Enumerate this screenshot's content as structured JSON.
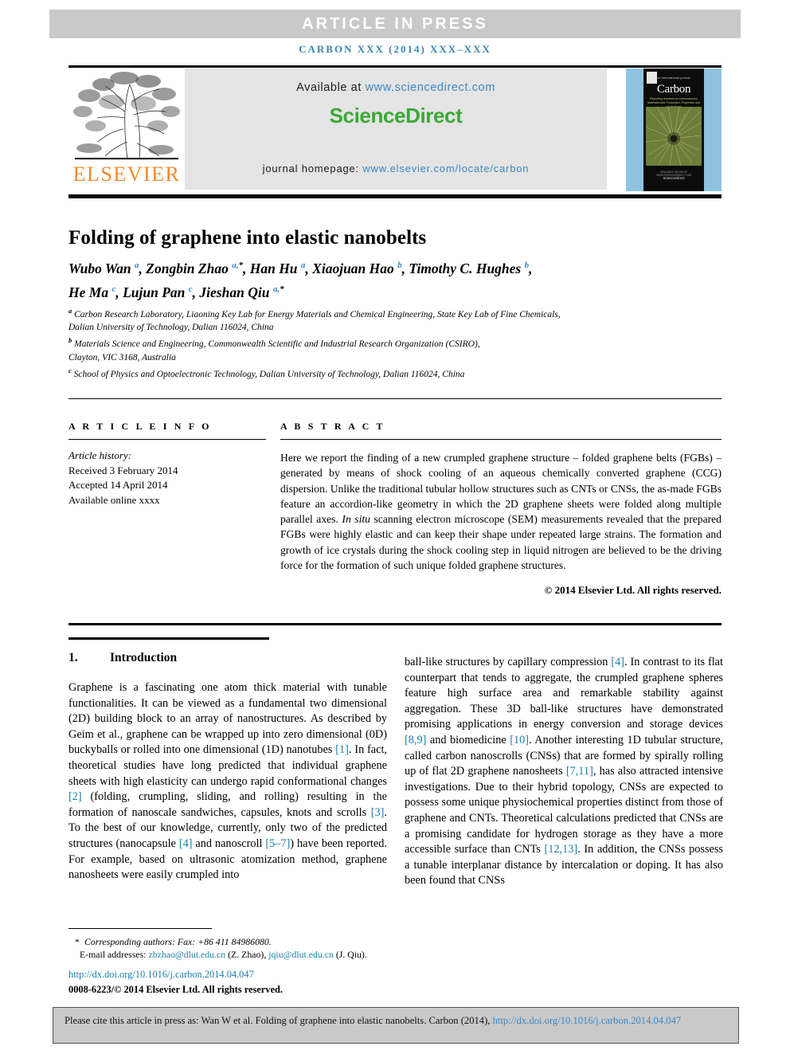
{
  "banner": {
    "article_in_press": "ARTICLE  IN  PRESS"
  },
  "running_head": "CARBON XXX (2014) XXX–XXX",
  "masthead": {
    "publisher_name": "ELSEVIER",
    "available_prefix": "Available at ",
    "available_link": "www.sciencedirect.com",
    "sciencedirect_logo": "ScienceDirect",
    "homepage_prefix": "journal homepage: ",
    "homepage_link": "www.elsevier.com/locate/carbon",
    "cover": {
      "kicker": "an international journal",
      "title": "Carbon",
      "subtitle": "Reporting research on Carbonaceous Materials their Production, Properties and Applications",
      "footer_small": "AVAILABLE ONLINE AT WWW.SCIENCEDIRECT.COM",
      "footer_brand": "ScienceDirect"
    }
  },
  "article": {
    "title": "Folding of graphene into elastic nanobelts",
    "authors_line_1": "Wubo Wan <sup>a</sup>, Zongbin Zhao <sup>a,<span class=\"star\">*</span></sup>, Han Hu <sup>a</sup>, Xiaojuan Hao <sup>b</sup>, Timothy C. Hughes <sup>b</sup>,",
    "authors_line_2": "He Ma <sup>c</sup>, Lujun Pan <sup>c</sup>, Jieshan Qiu <sup>a,<span class=\"star\">*</span></sup>",
    "affiliations": "<sup>a</sup> Carbon Research Laboratory, Liaoning Key Lab for Energy Materials and Chemical Engineering, State Key Lab of Fine Chemicals,<br>Dalian University of Technology, Dalian 116024, China<br><sup>b</sup> Materials Science and Engineering, Commonwealth Scientific and Industrial Research Organization (CSIRO),<br>Clayton, VIC 3168, Australia<br><sup>c</sup> School of Physics and Optoelectronic Technology, Dalian University of Technology, Dalian 116024, China"
  },
  "article_info": {
    "heading": "A R T I C L E   I N F O",
    "history_label": "Article history:",
    "received": "Received 3 February 2014",
    "accepted": "Accepted 14 April 2014",
    "available_online": "Available online xxxx"
  },
  "abstract": {
    "heading": "A B S T R A C T",
    "body": "Here we report the finding of a new crumpled graphene structure – folded graphene belts (FGBs) – generated by means of shock cooling of an aqueous chemically converted graphene (CCG) dispersion. Unlike the traditional tubular hollow structures such as CNTs or CNSs, the as-made FGBs feature an accordion-like geometry in which the 2D graphene sheets were folded along multiple parallel axes. <span class=\"ital\">In situ</span> scanning electron microscope (SEM) measurements revealed that the prepared FGBs were highly elastic and can keep their shape under repeated large strains. The formation and growth of ice crystals during the shock cooling step in liquid nitrogen are believed to be the driving force for the formation of such unique folded graphene structures.",
    "rights": "© 2014 Elsevier Ltd. All rights reserved."
  },
  "introduction": {
    "number": "1.",
    "heading": "Introduction",
    "left_column": "Graphene is a fascinating one atom thick material with tunable functionalities. It can be viewed as a fundamental two dimensional (2D) building block to an array of nanostructures. As described by Geim et al., graphene can be wrapped up into zero dimensional (0D) buckyballs or rolled into one dimensional (1D) nanotubes <span class=\"ref\">[1]</span>. In fact, theoretical studies have long predicted that individual graphene sheets with high elasticity can undergo rapid conformational changes <span class=\"ref\">[2]</span> (folding, crumpling, sliding, and rolling) resulting in the formation of nanoscale sandwiches, capsules, knots and scrolls <span class=\"ref\">[3]</span>. To the best of our knowledge, currently, only two of the predicted structures (nanocapsule <span class=\"ref\">[4]</span> and nanoscroll <span class=\"ref\">[5–7]</span>) have been reported. For example, based on ultrasonic atomization method, graphene nanosheets were easily crumpled into",
    "right_column": "ball-like structures by capillary compression <span class=\"ref\">[4]</span>. In contrast to its flat counterpart that tends to aggregate, the crumpled graphene spheres feature high surface area and remarkable stability against aggregation. These 3D ball-like structures have demonstrated promising applications in energy conversion and storage devices <span class=\"ref\">[8,9]</span> and biomedicine <span class=\"ref\">[10]</span>. Another interesting 1D tubular structure, called carbon nanoscrolls (CNSs) that are formed by spirally rolling up of flat 2D graphene nanosheets <span class=\"ref\">[7,11]</span>, has also attracted intensive investigations. Due to their hybrid topology, CNSs are expected to possess some unique physiochemical properties distinct from those of graphene and CNTs. Theoretical calculations predicted that CNSs are a promising candidate for hydrogen storage as they have a more accessible surface than CNTs <span class=\"ref\">[12,13]</span>. In addition, the CNSs possess a tunable interplanar distance by intercalation or doping. It has also been found that CNSs"
  },
  "footnotes": {
    "corresponding": "Corresponding authors: Fax: +86 411 84986080.",
    "emails": "E-mail addresses: <span class=\"lnk\">zbzhao@dlut.edu.cn</span> (Z. Zhao), <span class=\"lnk\">jqiu@dlut.edu.cn</span> (J. Qiu).",
    "doi": "http://dx.doi.org/10.1016/j.carbon.2014.04.047",
    "issn": "0008-6223/© 2014 Elsevier Ltd. All rights reserved."
  },
  "cite_box": {
    "text": "Please cite this article in press as: Wan W et al. Folding of graphene into elastic nanobelts. Carbon (2014), <span class=\"lnk\">http://dx.doi.org/10.1016/j.carbon.2014.04.047</span>"
  },
  "colors": {
    "banner_gray": "#c9c9c9",
    "link_blue": "#3a87c4",
    "ref_blue": "#1b7fa8",
    "sciencedirect_green": "#3aa935",
    "elsevier_orange": "#f0892a",
    "cover_blue": "#8fc3e0"
  }
}
